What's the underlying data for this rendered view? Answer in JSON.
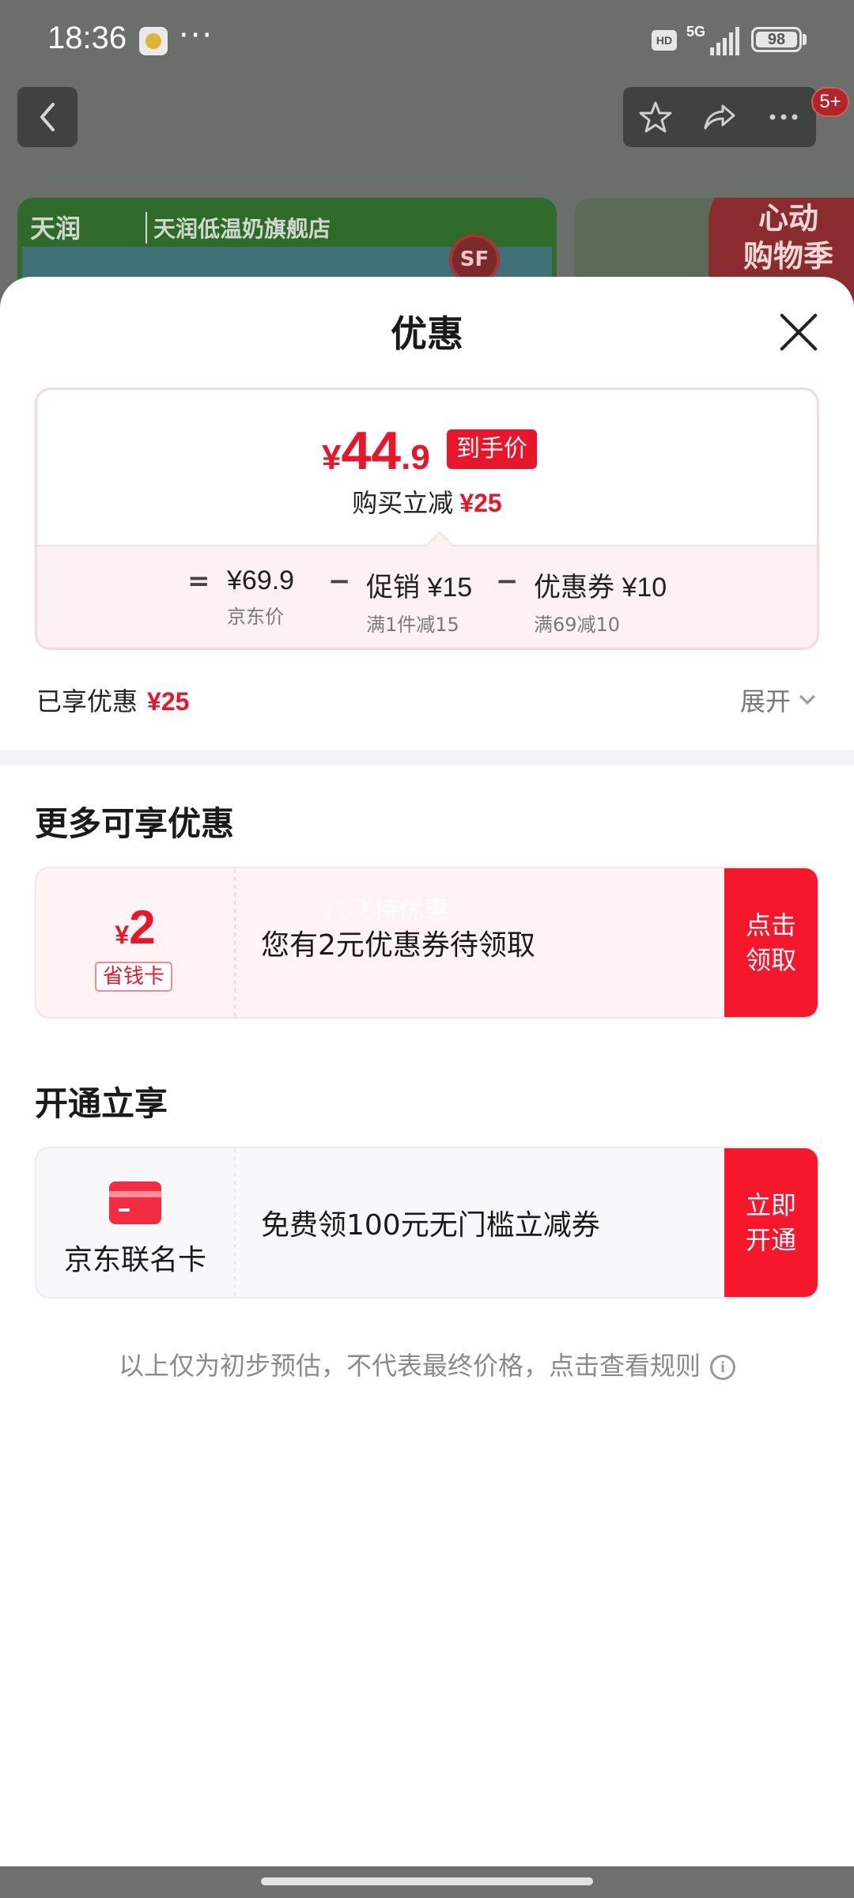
{
  "status_bar": {
    "time": "18:36",
    "more": "···",
    "hd": "HD",
    "network": "5G",
    "battery": "98"
  },
  "background_page": {
    "store_logo": "天润",
    "store_name": "天润低温奶旗舰店",
    "sf_badge": "SF",
    "promo_line1": "心动",
    "promo_line2": "购物季",
    "cart_badge": "5+"
  },
  "sheet": {
    "title": "优惠",
    "final_price": {
      "yen": "¥",
      "integer": "44",
      "decimal": ".9",
      "tag": "到手价"
    },
    "reduction": {
      "label": "购买立减",
      "amount": "¥25"
    },
    "breakdown": {
      "equals": "=",
      "minus": "−",
      "items": [
        {
          "main": "¥69.9",
          "sub": "京东价"
        },
        {
          "main": "促销 ¥15",
          "sub": "满1件减15"
        },
        {
          "main": "优惠券 ¥10",
          "sub": "满69减10"
        }
      ]
    },
    "enjoyed": {
      "label": "已享优惠",
      "amount": "¥25",
      "expand_label": "展开"
    },
    "more_offers": {
      "title": "更多可享优惠",
      "coupon_yen": "¥",
      "coupon_amount": "2",
      "coupon_tag": "省钱卡",
      "watermark": "八飞特优惠",
      "description": "您有2元优惠券待领取",
      "button_line1": "点击",
      "button_line2": "领取"
    },
    "activate": {
      "title": "开通立享",
      "card_name": "京东联名卡",
      "description": "免费领100元无门槛立减券",
      "button_line1": "立即",
      "button_line2": "开通"
    },
    "disclaimer": "以上仅为初步预估，不代表最终价格，点击查看规则",
    "info_glyph": "i"
  },
  "colors": {
    "accent_red": "#e9162b",
    "button_red": "#f7172d"
  }
}
